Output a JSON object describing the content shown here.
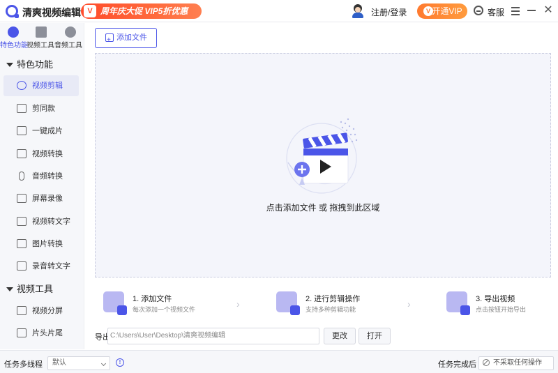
{
  "app": {
    "title": "清爽视频编辑",
    "promo_label": "周年庆大促 VIP5折优惠",
    "promo_badge": "V",
    "login_label": "注册/登录",
    "vip_label": "开通VIP",
    "service_label": "客服"
  },
  "sidebar": {
    "tabs": [
      {
        "label": "特色功能",
        "icon": "star-icon"
      },
      {
        "label": "视频工具",
        "icon": "film-icon"
      },
      {
        "label": "音频工具",
        "icon": "music-icon"
      }
    ],
    "sections": [
      {
        "title": "特色功能",
        "items": [
          {
            "label": "视频剪辑",
            "icon": "video-edit-icon"
          },
          {
            "label": "剪同款",
            "icon": "template-icon"
          },
          {
            "label": "一键成片",
            "icon": "auto-create-icon"
          },
          {
            "label": "视频转换",
            "icon": "video-convert-icon"
          },
          {
            "label": "音频转换",
            "icon": "microphone-icon"
          },
          {
            "label": "屏幕录像",
            "icon": "screen-record-icon"
          },
          {
            "label": "视频转文字",
            "icon": "video-to-text-icon"
          },
          {
            "label": "图片转换",
            "icon": "image-convert-icon"
          },
          {
            "label": "录音转文字",
            "icon": "audio-to-text-icon"
          }
        ]
      },
      {
        "title": "视频工具",
        "items": [
          {
            "label": "视频分屏",
            "icon": "split-screen-icon"
          },
          {
            "label": "片头片尾",
            "icon": "intro-outro-icon"
          }
        ]
      }
    ]
  },
  "main": {
    "add_file_label": "添加文件",
    "drop_text": "点击添加文件 或 拖拽到此区域",
    "steps": [
      {
        "title": "1. 添加文件",
        "desc": "每次添加一个视频文件"
      },
      {
        "title": "2. 进行剪辑操作",
        "desc": "支持多种剪辑功能"
      },
      {
        "title": "3. 导出视频",
        "desc": "点击按钮开始导出"
      }
    ],
    "export": {
      "label": "导出目录",
      "path": "C:\\Users\\User\\Desktop\\清爽视频编辑",
      "change_label": "更改",
      "open_label": "打开"
    }
  },
  "bottombar": {
    "threads_label": "任务多线程",
    "threads_value": "默认",
    "after_label": "任务完成后",
    "after_value": "不采取任何操作"
  },
  "colors": {
    "accent": "#4b55e8",
    "promo": "#ff4b2b",
    "vip": "#ff7a2f"
  }
}
